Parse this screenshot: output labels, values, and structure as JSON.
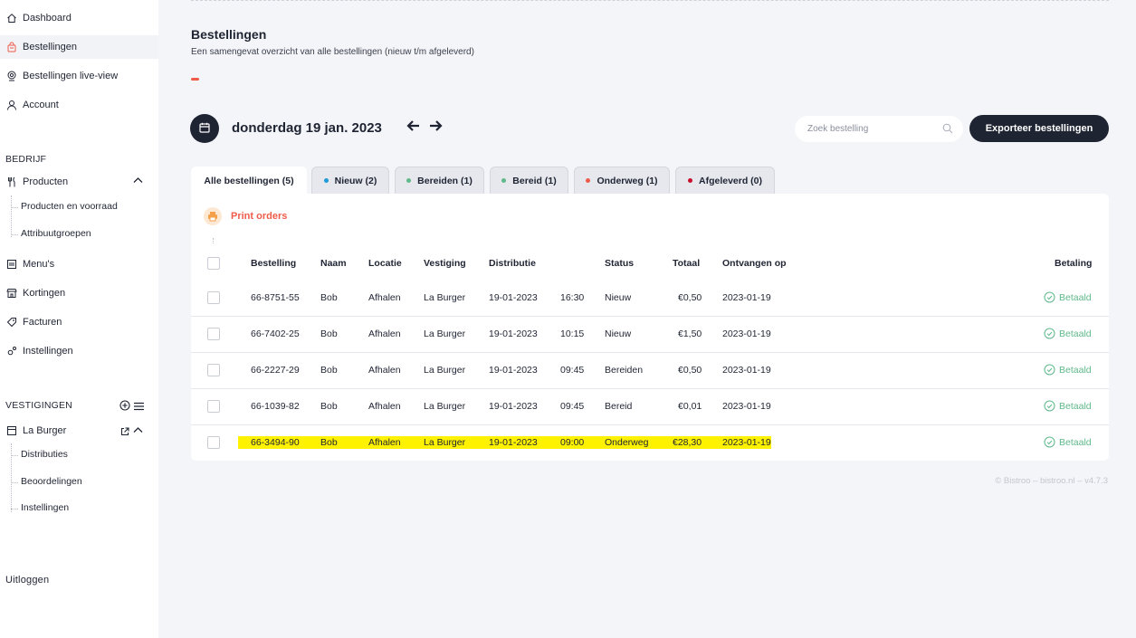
{
  "sidebar": {
    "items": [
      {
        "label": "Dashboard",
        "icon": "home-icon"
      },
      {
        "label": "Bestellingen",
        "icon": "bag-icon"
      },
      {
        "label": "Bestellingen live-view",
        "icon": "live-view-icon"
      },
      {
        "label": "Account",
        "icon": "user-icon"
      }
    ],
    "company_title": "BEDRIJF",
    "company_items": {
      "products": "Producten",
      "products_stock": "Producten en voorraad",
      "attribute_groups": "Attribuutgroepen",
      "menus": "Menu's",
      "discounts": "Kortingen",
      "invoices": "Facturen",
      "settings": "Instellingen"
    },
    "locations_title": "VESTIGINGEN",
    "location": {
      "name": "La Burger",
      "distributions": "Distributies",
      "reviews": "Beoordelingen",
      "settings": "Instellingen"
    },
    "logout": "Uitloggen"
  },
  "header": {
    "title": "Bestellingen",
    "subtitle": "Een samengevat overzicht van alle bestellingen (nieuw t/m afgeleverd)"
  },
  "toolbar": {
    "date": "donderdag 19 jan. 2023",
    "prev_arrow": "🡐",
    "next_arrow": "🡒",
    "search_placeholder": "Zoek bestelling",
    "export_label": "Exporteer bestellingen"
  },
  "tabs": [
    {
      "label": "Alle bestellingen (5)",
      "dot": null
    },
    {
      "label": "Nieuw (2)",
      "dot": "#1e9bd7"
    },
    {
      "label": "Bereiden (1)",
      "dot": "#5fb98a"
    },
    {
      "label": "Bereid (1)",
      "dot": "#5fb98a"
    },
    {
      "label": "Onderweg (1)",
      "dot": "#ef5b4a"
    },
    {
      "label": "Afgeleverd (0)",
      "dot": "#c8102e"
    }
  ],
  "print_label": "Print orders",
  "table": {
    "columns": [
      "Bestelling",
      "Naam",
      "Locatie",
      "Vestiging",
      "Distributie",
      "Status",
      "Totaal",
      "Ontvangen op",
      "Betaling"
    ],
    "rows": [
      {
        "order": "66-8751-55",
        "name": "Bob",
        "location": "Afhalen",
        "branch": "La Burger",
        "date": "19-01-2023",
        "time": "16:30",
        "status": "Nieuw",
        "total": "€0,50",
        "received": "2023-01-19",
        "payment": "Betaald"
      },
      {
        "order": "66-7402-25",
        "name": "Bob",
        "location": "Afhalen",
        "branch": "La Burger",
        "date": "19-01-2023",
        "time": "10:15",
        "status": "Nieuw",
        "total": "€1,50",
        "received": "2023-01-19",
        "payment": "Betaald"
      },
      {
        "order": "66-2227-29",
        "name": "Bob",
        "location": "Afhalen",
        "branch": "La Burger",
        "date": "19-01-2023",
        "time": "09:45",
        "status": "Bereiden",
        "total": "€0,50",
        "received": "2023-01-19",
        "payment": "Betaald"
      },
      {
        "order": "66-1039-82",
        "name": "Bob",
        "location": "Afhalen",
        "branch": "La Burger",
        "date": "19-01-2023",
        "time": "09:45",
        "status": "Bereid",
        "total": "€0,01",
        "received": "2023-01-19",
        "payment": "Betaald"
      },
      {
        "order": "66-3494-90",
        "name": "Bob",
        "location": "Afhalen",
        "branch": "La Burger",
        "date": "19-01-2023",
        "time": "09:00",
        "status": "Onderweg",
        "total": "€28,30",
        "received": "2023-01-19",
        "payment": "Betaald"
      }
    ]
  },
  "colors": {
    "accent": "#ef5b4a",
    "dark": "#1f2433",
    "paid": "#5fb98a",
    "highlight": "#fff200"
  },
  "footer": "© Bistroo – bistroo.nl – v4.7.3"
}
